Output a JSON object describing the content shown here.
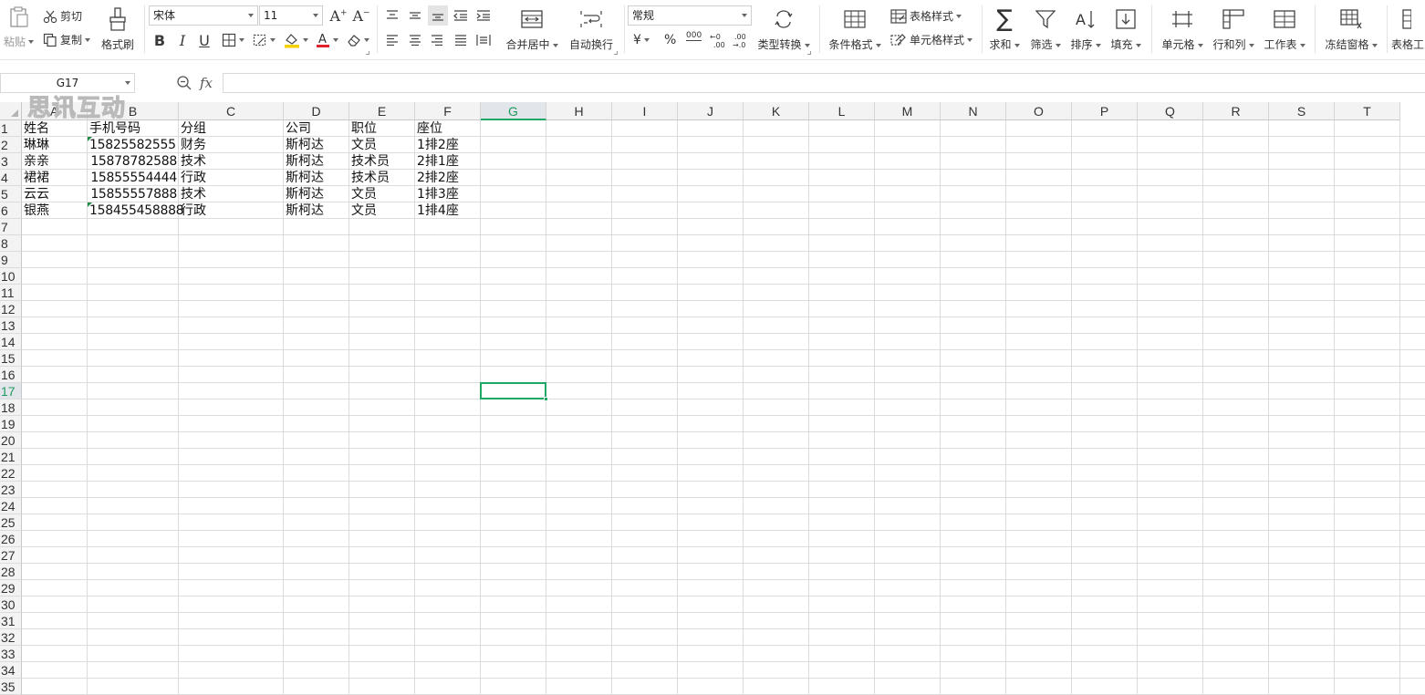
{
  "ribbon": {
    "paste": "粘贴",
    "cut": "剪切",
    "copy": "复制",
    "format_painter": "格式刷",
    "font_name": "宋体",
    "font_size": "11",
    "bold": "B",
    "italic": "I",
    "underline": "U",
    "merge_center": "合并居中",
    "wrap_text": "自动换行",
    "number_format": "常规",
    "currency": "¥",
    "percent": "%",
    "thousands": "000",
    "type_convert": "类型转换",
    "cond_format": "条件格式",
    "table_style": "表格样式",
    "cell_style": "单元格样式",
    "sum": "求和",
    "filter": "筛选",
    "sort": "排序",
    "fill": "填充",
    "cell": "单元格",
    "row_col": "行和列",
    "worksheet": "工作表",
    "freeze": "冻结窗格",
    "table_tools": "表格工"
  },
  "formula_bar": {
    "name_box": "G17",
    "fx": "fx",
    "formula": ""
  },
  "watermark": "思讯互动",
  "columns": [
    "A",
    "B",
    "C",
    "D",
    "E",
    "F",
    "G",
    "H",
    "I",
    "J",
    "K",
    "L",
    "M",
    "N",
    "O",
    "P",
    "Q",
    "R",
    "S",
    "T"
  ],
  "rows": [
    "1",
    "2",
    "3",
    "4",
    "5",
    "6",
    "7",
    "8",
    "9",
    "10",
    "11",
    "12",
    "13",
    "14",
    "15",
    "16",
    "17",
    "18",
    "19",
    "20",
    "21",
    "22",
    "23",
    "24",
    "25",
    "26",
    "27",
    "28",
    "29",
    "30",
    "31",
    "32",
    "33",
    "34",
    "35"
  ],
  "active_cell": {
    "col": "G",
    "row": "17"
  },
  "sheet": {
    "header": [
      "姓名",
      "手机号码",
      "分组",
      "公司",
      "职位",
      "座位"
    ],
    "data": [
      {
        "name": "琳琳",
        "phone": "15825582555",
        "phone_as_text": true,
        "group": "财务",
        "company": "斯柯达",
        "position": "文员",
        "seat": "1排2座"
      },
      {
        "name": "亲亲",
        "phone": "15878782588",
        "phone_as_text": false,
        "group": "技术",
        "company": "斯柯达",
        "position": "技术员",
        "seat": "2排1座"
      },
      {
        "name": "裙裙",
        "phone": "15855554444",
        "phone_as_text": false,
        "group": "行政",
        "company": "斯柯达",
        "position": "技术员",
        "seat": "2排2座"
      },
      {
        "name": "云云",
        "phone": "15855557888",
        "phone_as_text": false,
        "group": "技术",
        "company": "斯柯达",
        "position": "文员",
        "seat": "1排3座"
      },
      {
        "name": "银燕",
        "phone": "158455458888",
        "phone_as_text": true,
        "group": "行政",
        "company": "斯柯达",
        "position": "文员",
        "seat": "1排4座"
      }
    ]
  },
  "colors": {
    "accent": "#1fa865",
    "grid": "#dcdcdc",
    "header_bg": "#f3f3f3",
    "text_flag": "#1e8c45"
  }
}
